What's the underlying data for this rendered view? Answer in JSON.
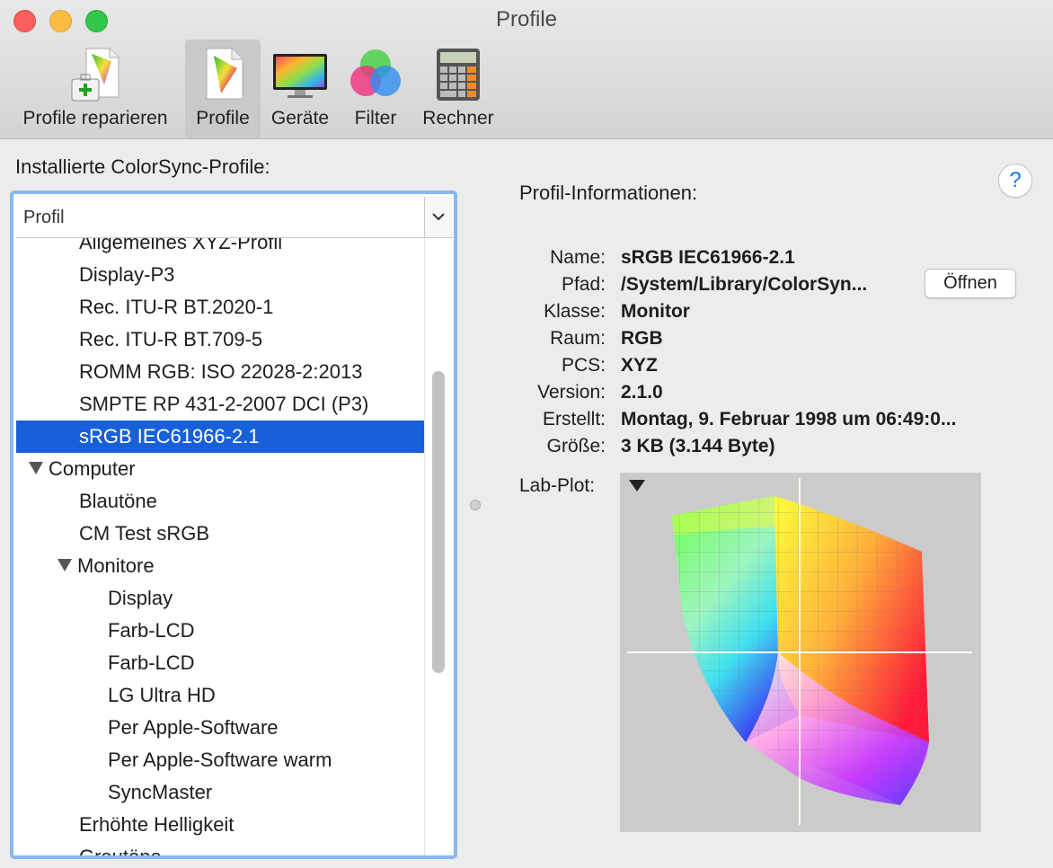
{
  "window": {
    "title": "Profile"
  },
  "toolbar": {
    "items": [
      {
        "label": "Profile reparieren",
        "icon": "first-aid-profile-icon"
      },
      {
        "label": "Profile",
        "icon": "colorsync-profile-icon",
        "selected": true
      },
      {
        "label": "Geräte",
        "icon": "display-device-icon"
      },
      {
        "label": "Filter",
        "icon": "color-filter-icon"
      },
      {
        "label": "Rechner",
        "icon": "calculator-icon"
      }
    ]
  },
  "left": {
    "heading": "Installierte ColorSync-Profile:",
    "popup_value": "Profil",
    "rows": [
      {
        "label": "Allgemeines XYZ-Profil",
        "indent": 1
      },
      {
        "label": "Display-P3",
        "indent": 1
      },
      {
        "label": "Rec. ITU-R BT.2020-1",
        "indent": 1
      },
      {
        "label": "Rec. ITU-R BT.709-5",
        "indent": 1
      },
      {
        "label": "ROMM RGB: ISO 22028-2:2013",
        "indent": 1
      },
      {
        "label": "SMPTE RP 431-2-2007 DCI (P3)",
        "indent": 1
      },
      {
        "label": "sRGB IEC61966-2.1",
        "indent": 1,
        "selected": true
      },
      {
        "label": "Computer",
        "indent": 0,
        "disclosure": true
      },
      {
        "label": "Blautöne",
        "indent": 1
      },
      {
        "label": "CM Test sRGB",
        "indent": 1
      },
      {
        "label": "Monitore",
        "indent": 1,
        "disclosure": true
      },
      {
        "label": "Display",
        "indent": 2
      },
      {
        "label": "Farb-LCD",
        "indent": 2
      },
      {
        "label": "Farb-LCD",
        "indent": 2
      },
      {
        "label": "LG Ultra HD",
        "indent": 2
      },
      {
        "label": "Per Apple-Software",
        "indent": 2
      },
      {
        "label": "Per Apple-Software warm",
        "indent": 2
      },
      {
        "label": "SyncMaster",
        "indent": 2
      },
      {
        "label": "Erhöhte Helligkeit",
        "indent": 1
      },
      {
        "label": "Grautöne",
        "indent": 1
      }
    ]
  },
  "right": {
    "help_label": "?",
    "heading": "Profil-Informationen:",
    "fields": {
      "name": {
        "label": "Name:",
        "value": "sRGB IEC61966-2.1"
      },
      "path": {
        "label": "Pfad:",
        "value": "/System/Library/ColorSyn..."
      },
      "class": {
        "label": "Klasse:",
        "value": "Monitor"
      },
      "space": {
        "label": "Raum:",
        "value": "RGB"
      },
      "pcs": {
        "label": "PCS:",
        "value": "XYZ"
      },
      "version": {
        "label": "Version:",
        "value": "2.1.0"
      },
      "created": {
        "label": "Erstellt:",
        "value": "Montag, 9. Februar 1998 um 06:49:0..."
      },
      "size": {
        "label": "Größe:",
        "value": "3 KB (3.144 Byte)"
      }
    },
    "open_button": "Öffnen",
    "lab_plot_label": "Lab-Plot:"
  },
  "colors": {
    "selection": "#1860d8",
    "focus_ring": "#8ab8f0",
    "plot_background": "#cbcbcb"
  }
}
